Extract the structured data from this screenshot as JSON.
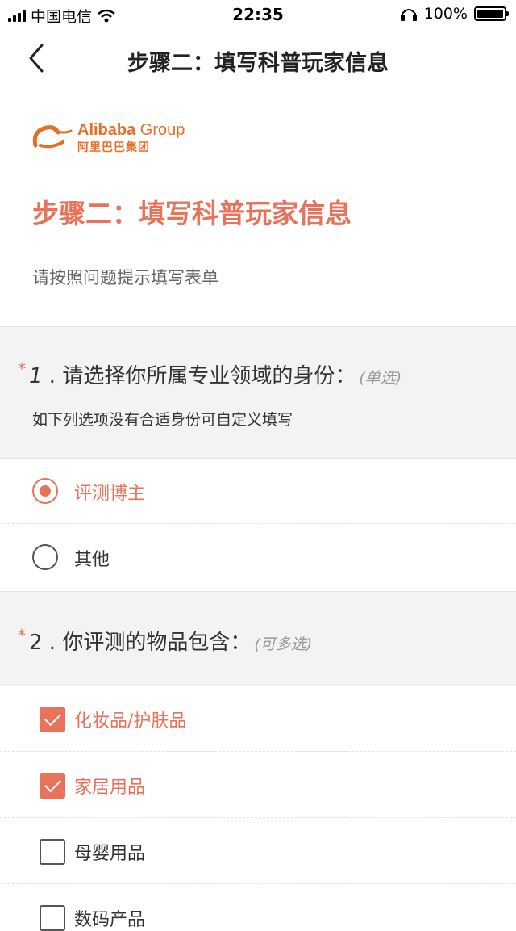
{
  "status_bar": {
    "carrier": "中国电信",
    "time": "22:35",
    "battery": "100%",
    "icons": [
      "signal-icon",
      "wifi-icon",
      "headphones-icon",
      "battery-icon"
    ]
  },
  "nav": {
    "title": "步骤二：填写科普玩家信息",
    "back_icon": "chevron-left-icon"
  },
  "intro": {
    "logo_en_bold": "Alibaba",
    "logo_en_light": " Group",
    "logo_cn": "阿里巴巴集团",
    "heading": "步骤二：填写科普玩家信息",
    "description": "请按照问题提示填写表单"
  },
  "questions": [
    {
      "required_mark": "*",
      "number": "1",
      "text": " . 请选择你所属专业领域的身份：",
      "hint": "(单选)",
      "subtitle": "如下列选项没有合适身份可自定义填写",
      "options": [
        {
          "label": "评测博主",
          "selected": true
        },
        {
          "label": "其他",
          "selected": false
        }
      ]
    },
    {
      "required_mark": "*",
      "number": "2",
      "text": " . 你评测的物品包含：",
      "hint": "(可多选)",
      "options": [
        {
          "label": "化妆品/护肤品",
          "checked": true
        },
        {
          "label": "家居用品",
          "checked": true
        },
        {
          "label": "母婴用品",
          "checked": false
        },
        {
          "label": "数码产品",
          "checked": false
        }
      ]
    }
  ],
  "colors": {
    "accent": "#e8735a",
    "brand": "#e66f26",
    "section_bg": "#f3f3f3"
  }
}
